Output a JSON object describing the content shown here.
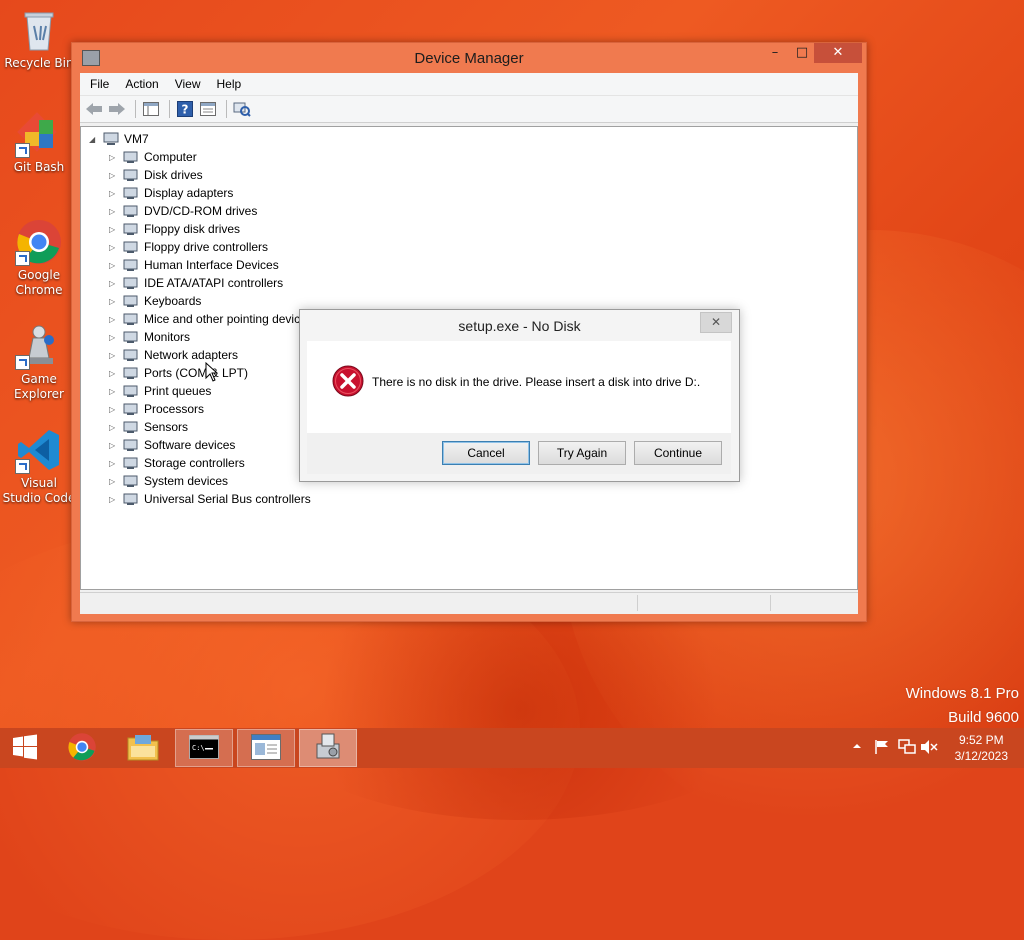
{
  "desktop": {
    "icons": [
      {
        "label": "Recycle Bin",
        "icon": "recycle-bin-icon"
      },
      {
        "label": "Git Bash",
        "icon": "git-bash-icon"
      },
      {
        "label": "Google Chrome",
        "icon": "chrome-icon"
      },
      {
        "label": "Game Explorer",
        "icon": "game-explorer-icon"
      },
      {
        "label": "Visual Studio Code",
        "icon": "vscode-icon"
      }
    ],
    "watermark": {
      "line1": "Windows 8.1 Pro",
      "line2": "Build 9600"
    }
  },
  "window": {
    "title": "Device Manager",
    "menu": [
      "File",
      "Action",
      "View",
      "Help"
    ],
    "toolbar": [
      "back-icon",
      "forward-icon",
      "show-hide-console-tree-icon",
      "help-icon",
      "properties-icon",
      "scan-hardware-icon"
    ],
    "tree": {
      "root": "VM7",
      "items": [
        "Computer",
        "Disk drives",
        "Display adapters",
        "DVD/CD-ROM drives",
        "Floppy disk drives",
        "Floppy drive controllers",
        "Human Interface Devices",
        "IDE ATA/ATAPI controllers",
        "Keyboards",
        "Mice and other pointing devic",
        "Monitors",
        "Network adapters",
        "Ports (COM & LPT)",
        "Print queues",
        "Processors",
        "Sensors",
        "Software devices",
        "Storage controllers",
        "System devices",
        "Universal Serial Bus controllers"
      ]
    }
  },
  "dialog": {
    "title": "setup.exe - No Disk",
    "message": "There is no disk in the drive. Please insert a disk into drive D:.",
    "buttons": {
      "cancel": "Cancel",
      "try_again": "Try Again",
      "continue": "Continue"
    }
  },
  "taskbar": {
    "apps": [
      "start-icon",
      "chrome-icon",
      "file-explorer-icon",
      "command-prompt-icon",
      "generic-window-icon",
      "device-manager-icon"
    ],
    "clock": {
      "time": "9:52 PM",
      "date": "3/12/2023"
    }
  },
  "colors": {
    "accent": "#e24617",
    "taskbar": "#c9461f",
    "error": "#c8102e"
  }
}
